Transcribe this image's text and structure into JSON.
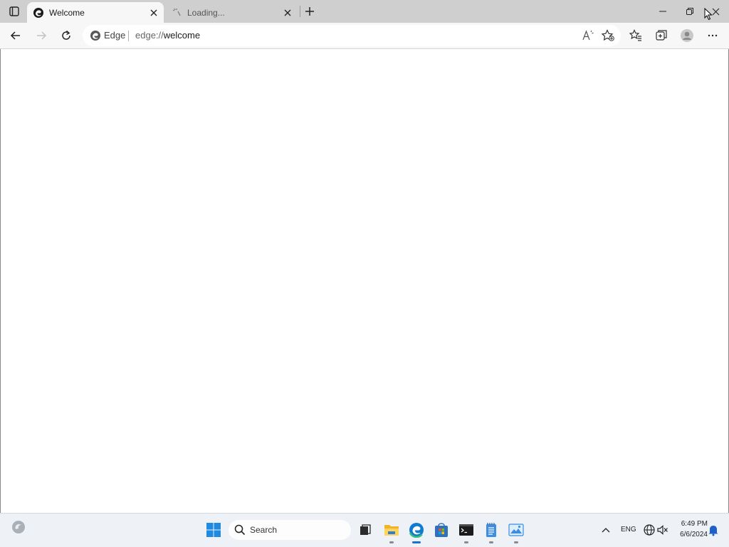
{
  "browser": {
    "tabs": [
      {
        "title": "Welcome",
        "state": "active",
        "icon": "edge-icon"
      },
      {
        "title": "Loading...",
        "state": "loading",
        "icon": "loading-spinner-icon"
      }
    ],
    "address_bar": {
      "chip": "Edge",
      "url_prefix": "edge://",
      "url_host": "welcome"
    },
    "toolbar_icons": [
      "back-icon",
      "forward-icon",
      "refresh-icon",
      "read-aloud-icon",
      "add-favorite-icon",
      "favorites-icon",
      "collections-icon",
      "profile-icon",
      "more-icon"
    ],
    "window_controls": [
      "minimize-icon",
      "restore-icon",
      "close-icon"
    ]
  },
  "taskbar": {
    "search_placeholder": "Search",
    "pinned": [
      "start-icon",
      "task-view-icon",
      "file-explorer-icon",
      "edge-icon",
      "store-icon",
      "terminal-icon",
      "notepad-icon",
      "photos-icon"
    ],
    "tray": {
      "language": "ENG",
      "time": "6:49 PM",
      "date": "6/6/2024"
    }
  },
  "colors": {
    "tabstrip_bg": "#cfcfcf",
    "toolbar_bg": "#f7f7f7",
    "taskbar_bg": "#eef1f6",
    "accent": "#1f6fd1"
  }
}
